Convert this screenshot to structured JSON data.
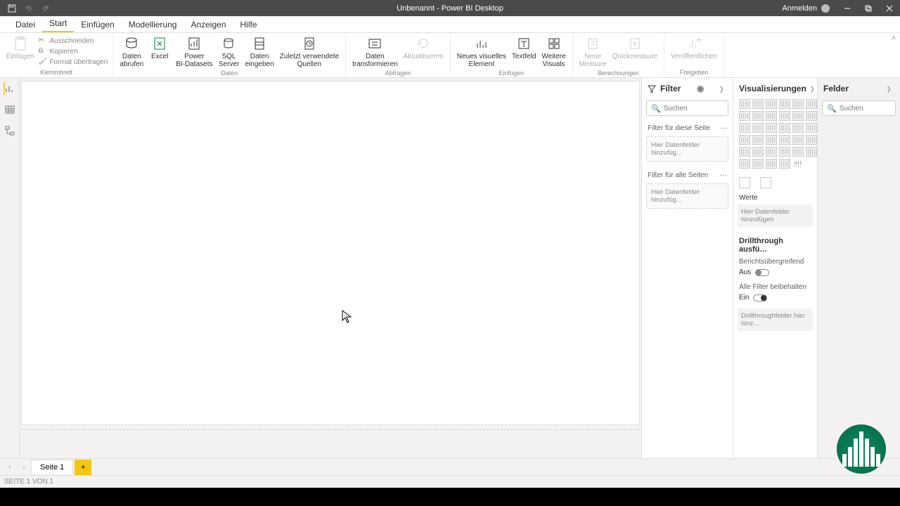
{
  "title": "Unbenannt - Power BI Desktop",
  "signin": "Anmelden",
  "tabs": {
    "file": "Datei",
    "start": "Start",
    "einfuegen": "Einfügen",
    "modellierung": "Modellierung",
    "anzeigen": "Anzeigen",
    "hilfe": "Hilfe"
  },
  "ribbon": {
    "clipboard": {
      "paste": "Einfügen",
      "cut": "Ausschneiden",
      "copy": "Kopieren",
      "format": "Format übertragen",
      "group": "Klemmbrett"
    },
    "data": {
      "get": "Daten\nabrufen",
      "excel": "Excel",
      "pbi": "Power\nBI-Datasets",
      "sql": "SQL\nServer",
      "enter": "Daten\neingeben",
      "recent": "Zuletzt verwendete\nQuellen",
      "group": "Daten"
    },
    "queries": {
      "transform": "Daten\ntransformieren",
      "refresh": "Aktualisieren",
      "group": "Abfragen"
    },
    "insert": {
      "visual": "Neues visuelles\nElement",
      "text": "Textfeld",
      "more": "Weitere\nVisuals",
      "group": "Einfügen"
    },
    "calc": {
      "measure": "Neue\nMeasure",
      "quick": "Quickmeasure",
      "group": "Berechnungen"
    },
    "share": {
      "publish": "Veröffentlichen",
      "group": "Freigeben"
    }
  },
  "filter": {
    "title": "Filter",
    "search": "Suchen",
    "page": "Filter für diese Seite",
    "pageDrop": "Hier Datenfelder hinzufüg...",
    "all": "Filter für alle Seiten",
    "allDrop": "Hier Datenfelder hinzufüg..."
  },
  "viz": {
    "title": "Visualisierungen",
    "werte": "Werte",
    "werteDrop": "Hier Datenfelder hinzufügen",
    "drill": "Drillthrough ausfü…",
    "cross": "Berichtsübergreifend",
    "off": "Aus",
    "keep": "Alle Filter beibehalten",
    "on": "Ein",
    "drillDrop": "Drillthroughfelder hier hinz..."
  },
  "fields": {
    "title": "Felder",
    "search": "Suchen"
  },
  "page": {
    "tab": "Seite 1",
    "add": "+"
  },
  "status": "SEITE 1 VON 1"
}
